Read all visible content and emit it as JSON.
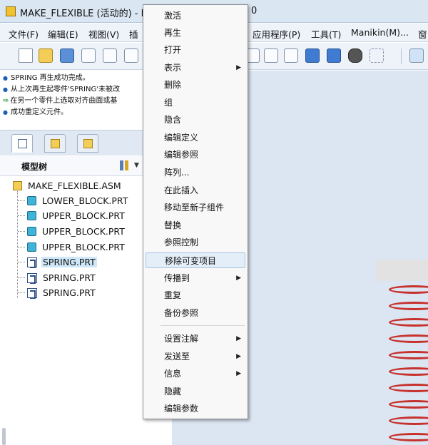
{
  "window": {
    "title": "MAKE_FLEXIBLE (活动的) - P",
    "title_tail": "0"
  },
  "menubar": {
    "items": [
      "文件(F)",
      "编辑(E)",
      "视图(V)",
      "插",
      "应用程序(P)",
      "工具(T)",
      "Manikin(M)...",
      "窗"
    ]
  },
  "toolbar": {
    "icons": [
      "new-file-icon",
      "open-folder-icon",
      "save-icon",
      "print-icon",
      "mail-icon",
      "globe-icon",
      "copy-icon",
      "paste-icon",
      "paste-special-icon",
      "regenerate-icon",
      "regenerate-manager-icon",
      "find-icon",
      "select-box-icon",
      "view-icon"
    ]
  },
  "messages": [
    {
      "icon": "bullet",
      "text": "SPRING 再生成功完成。"
    },
    {
      "icon": "bullet",
      "text": "从上次再生起零件'SPRING'未被改"
    },
    {
      "icon": "arrow",
      "text": "在另一个零件上选取对齐曲面或基"
    },
    {
      "icon": "bullet",
      "text": "成功重定义元件。"
    }
  ],
  "model_tree": {
    "header": "模型树",
    "root": "MAKE_FLEXIBLE.ASM",
    "items": [
      {
        "label": "LOWER_BLOCK.PRT",
        "type": "part",
        "selected": false
      },
      {
        "label": "UPPER_BLOCK.PRT",
        "type": "part",
        "selected": false
      },
      {
        "label": "UPPER_BLOCK.PRT",
        "type": "part",
        "selected": false
      },
      {
        "label": "UPPER_BLOCK.PRT",
        "type": "part",
        "selected": false
      },
      {
        "label": "SPRING.PRT",
        "type": "spring",
        "selected": true
      },
      {
        "label": "SPRING.PRT",
        "type": "spring",
        "selected": false
      },
      {
        "label": "SPRING.PRT",
        "type": "spring",
        "selected": false
      }
    ]
  },
  "context_menu": {
    "items": [
      {
        "label": "激活",
        "submenu": false
      },
      {
        "label": "再生",
        "submenu": false
      },
      {
        "label": "打开",
        "submenu": false
      },
      {
        "label": "表示",
        "submenu": true
      },
      {
        "label": "删除",
        "submenu": false
      },
      {
        "label": "组",
        "submenu": false
      },
      {
        "label": "隐含",
        "submenu": false
      },
      {
        "label": "编辑定义",
        "submenu": false
      },
      {
        "label": "编辑参照",
        "submenu": false
      },
      {
        "label": "阵列...",
        "submenu": false
      },
      {
        "label": "在此插入",
        "submenu": false
      },
      {
        "label": "移动至新子组件",
        "submenu": false
      },
      {
        "label": "替换",
        "submenu": false
      },
      {
        "label": "参照控制",
        "submenu": false
      },
      {
        "label": "移除可变项目",
        "submenu": false,
        "highlighted": true
      },
      {
        "label": "传播到",
        "submenu": true
      },
      {
        "label": "重复",
        "submenu": false
      },
      {
        "label": "备份参照",
        "submenu": false
      },
      {
        "label": "设置注解",
        "submenu": true,
        "separator_before": true
      },
      {
        "label": "发送至",
        "submenu": true
      },
      {
        "label": "信息",
        "submenu": true
      },
      {
        "label": "隐藏",
        "submenu": false
      },
      {
        "label": "编辑参数",
        "submenu": false
      }
    ]
  },
  "colors": {
    "spring": "#c7322d",
    "selection": "#cfe8f9",
    "menu_highlight": "#e4eef9"
  }
}
